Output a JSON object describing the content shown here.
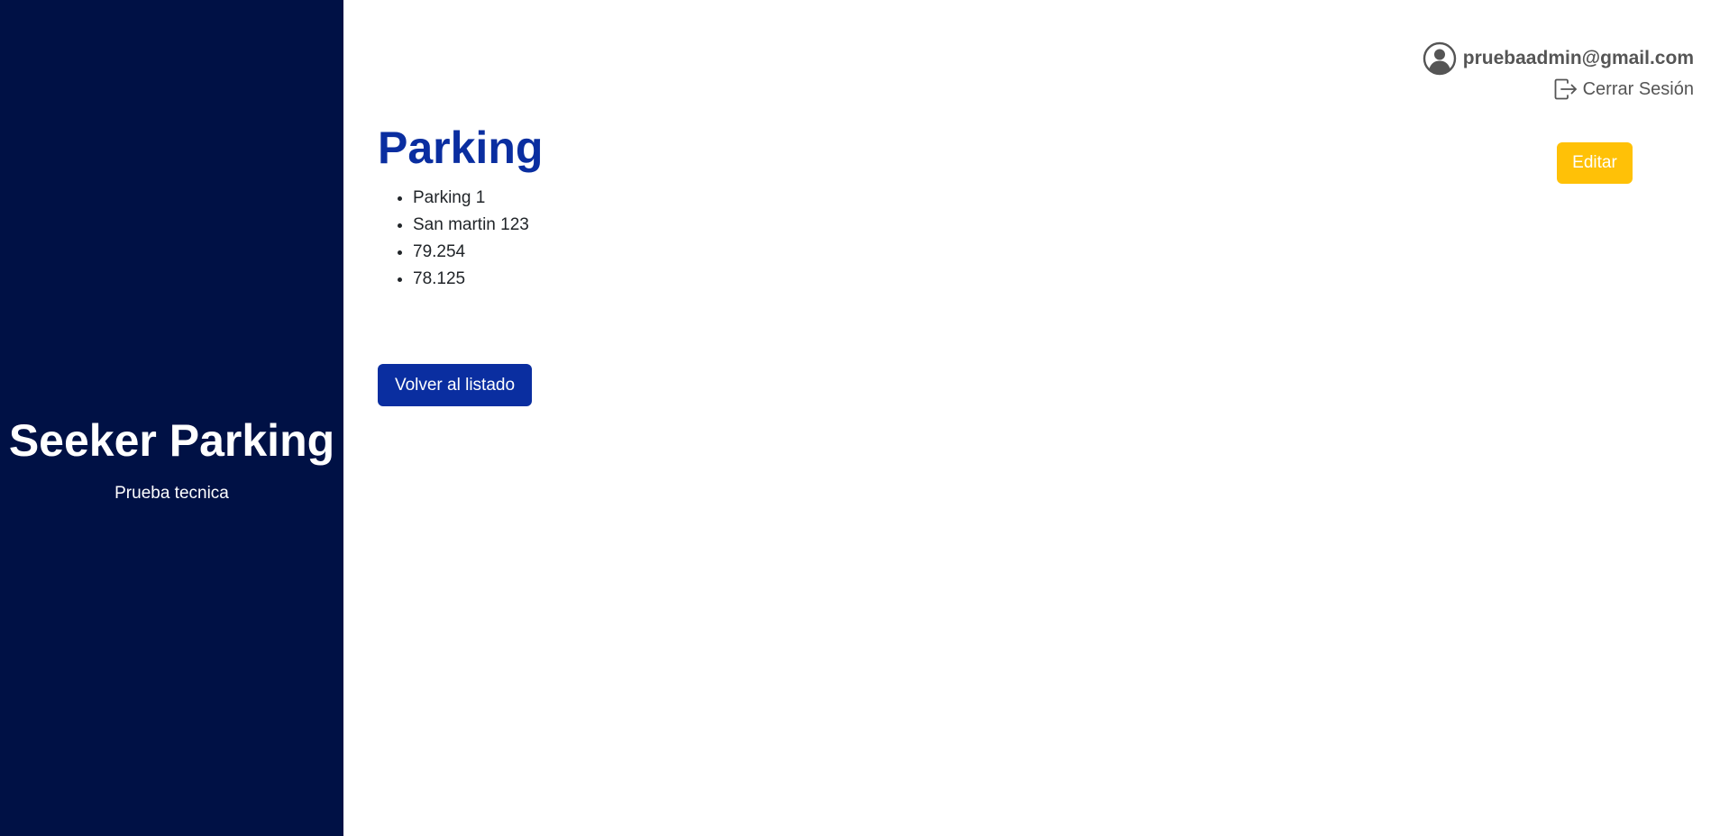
{
  "sidebar": {
    "title": "Seeker Parking",
    "subtitle": "Prueba tecnica",
    "background_color": "#001145"
  },
  "header": {
    "user_icon": "user-circle-icon",
    "user_email": "pruebaadmin@gmail.com",
    "logout_icon": "logout-icon",
    "logout_label": "Cerrar Sesión"
  },
  "main": {
    "title": "Parking",
    "edit_label": "Editar",
    "details": [
      "Parking 1",
      "San martin 123",
      "79.254",
      "78.125"
    ],
    "back_label": "Volver al listado"
  },
  "colors": {
    "primary": "#0a2ea0",
    "warning": "#ffc107",
    "sidebar": "#001145"
  }
}
